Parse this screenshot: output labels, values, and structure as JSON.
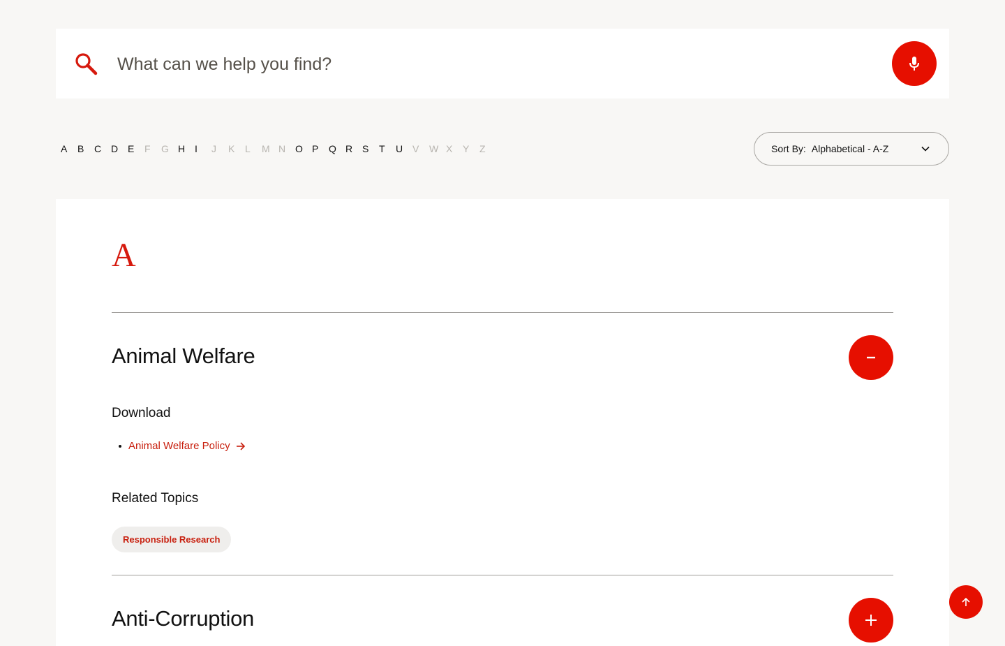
{
  "search": {
    "placeholder": "What can we help you find?",
    "icon": "search-icon",
    "mic_icon": "microphone-icon"
  },
  "alphabet": [
    {
      "letter": "A",
      "enabled": true
    },
    {
      "letter": "B",
      "enabled": true
    },
    {
      "letter": "C",
      "enabled": true
    },
    {
      "letter": "D",
      "enabled": true
    },
    {
      "letter": "E",
      "enabled": true
    },
    {
      "letter": "F",
      "enabled": false
    },
    {
      "letter": "G",
      "enabled": false
    },
    {
      "letter": "H",
      "enabled": true
    },
    {
      "letter": "I",
      "enabled": true
    },
    {
      "letter": "J",
      "enabled": false
    },
    {
      "letter": "K",
      "enabled": false
    },
    {
      "letter": "L",
      "enabled": false
    },
    {
      "letter": "M",
      "enabled": false
    },
    {
      "letter": "N",
      "enabled": false
    },
    {
      "letter": "O",
      "enabled": true
    },
    {
      "letter": "P",
      "enabled": true
    },
    {
      "letter": "Q",
      "enabled": true
    },
    {
      "letter": "R",
      "enabled": true
    },
    {
      "letter": "S",
      "enabled": true
    },
    {
      "letter": "T",
      "enabled": true
    },
    {
      "letter": "U",
      "enabled": true
    },
    {
      "letter": "V",
      "enabled": false
    },
    {
      "letter": "W",
      "enabled": false
    },
    {
      "letter": "X",
      "enabled": false
    },
    {
      "letter": "Y",
      "enabled": false
    },
    {
      "letter": "Z",
      "enabled": false
    }
  ],
  "sort": {
    "label": "Sort By:",
    "value": "Alphabetical - A-Z"
  },
  "section": {
    "letter": "A",
    "topics": [
      {
        "title": "Animal Welfare",
        "expanded": true,
        "download_heading": "Download",
        "download_link": "Animal Welfare Policy",
        "related_heading": "Related Topics",
        "related_chip": "Responsible Research"
      },
      {
        "title": "Anti-Corruption",
        "expanded": false
      }
    ]
  },
  "colors": {
    "accent": "#e60f00",
    "link": "#c8200f",
    "disabled_letter": "#b8b5b0"
  }
}
